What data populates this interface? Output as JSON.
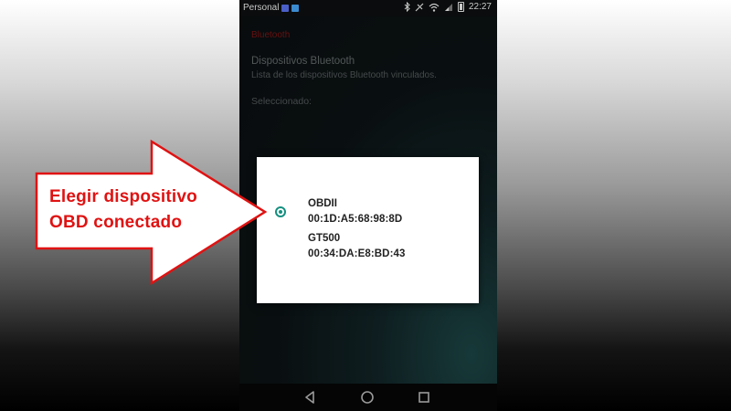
{
  "status_bar": {
    "carrier": "Personal",
    "time": "22:27",
    "icons": [
      "notification-icon",
      "gallery-icon",
      "bluetooth-icon",
      "vibrate-icon",
      "wifi-icon",
      "signal-icon",
      "battery-icon"
    ]
  },
  "settings": {
    "category": "Bluetooth",
    "title": "Dispositivos Bluetooth",
    "summary": "Lista de los dispositivos Bluetooth vinculados.",
    "selected_label": "Seleccionado:"
  },
  "dialog": {
    "devices": [
      {
        "name": "OBDII",
        "address": "00:1D:A5:68:98:8D",
        "selected": true
      },
      {
        "name": "GT500",
        "address": "00:34:DA:E8:BD:43",
        "selected": false
      }
    ]
  },
  "annotation": {
    "line1": "Elegir dispositivo",
    "line2": "OBD conectado",
    "color": "#e01212"
  },
  "colors": {
    "accent": "#139080",
    "category": "#8a1616"
  }
}
